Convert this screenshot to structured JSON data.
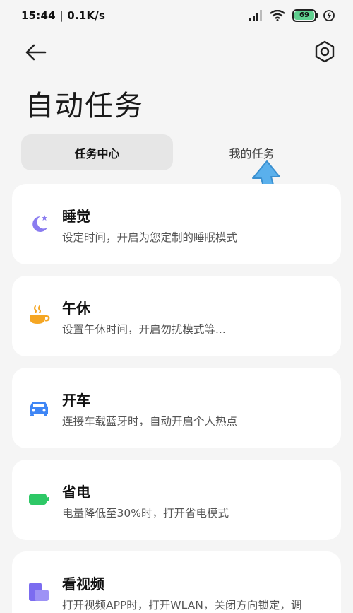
{
  "status_bar": {
    "time_speed": "15:44 | 0.1K/s",
    "battery_level": "69"
  },
  "header": {
    "title": "自动任务"
  },
  "tabs": [
    {
      "label": "任务中心",
      "active": true
    },
    {
      "label": "我的任务",
      "active": false
    }
  ],
  "tasks": [
    {
      "title": "睡觉",
      "description": "设定时间，开启为您定制的睡眠模式",
      "icon": "moon-star-icon",
      "color": "#8a7cf0"
    },
    {
      "title": "午休",
      "description": "设置午休时间，开启勿扰模式等...",
      "icon": "coffee-cup-icon",
      "color": "#f5a623"
    },
    {
      "title": "开车",
      "description": "连接车载蓝牙时，自动开启个人热点",
      "icon": "car-icon",
      "color": "#3f86f5"
    },
    {
      "title": "省电",
      "description": "电量降低至30%时，打开省电模式",
      "icon": "battery-icon",
      "color": "#2ec866"
    },
    {
      "title": "看视频",
      "description": "打开视频APP时，打开WLAN，关闭方向锁定，调",
      "icon": "video-icon",
      "color": "#7b6cf0"
    }
  ]
}
